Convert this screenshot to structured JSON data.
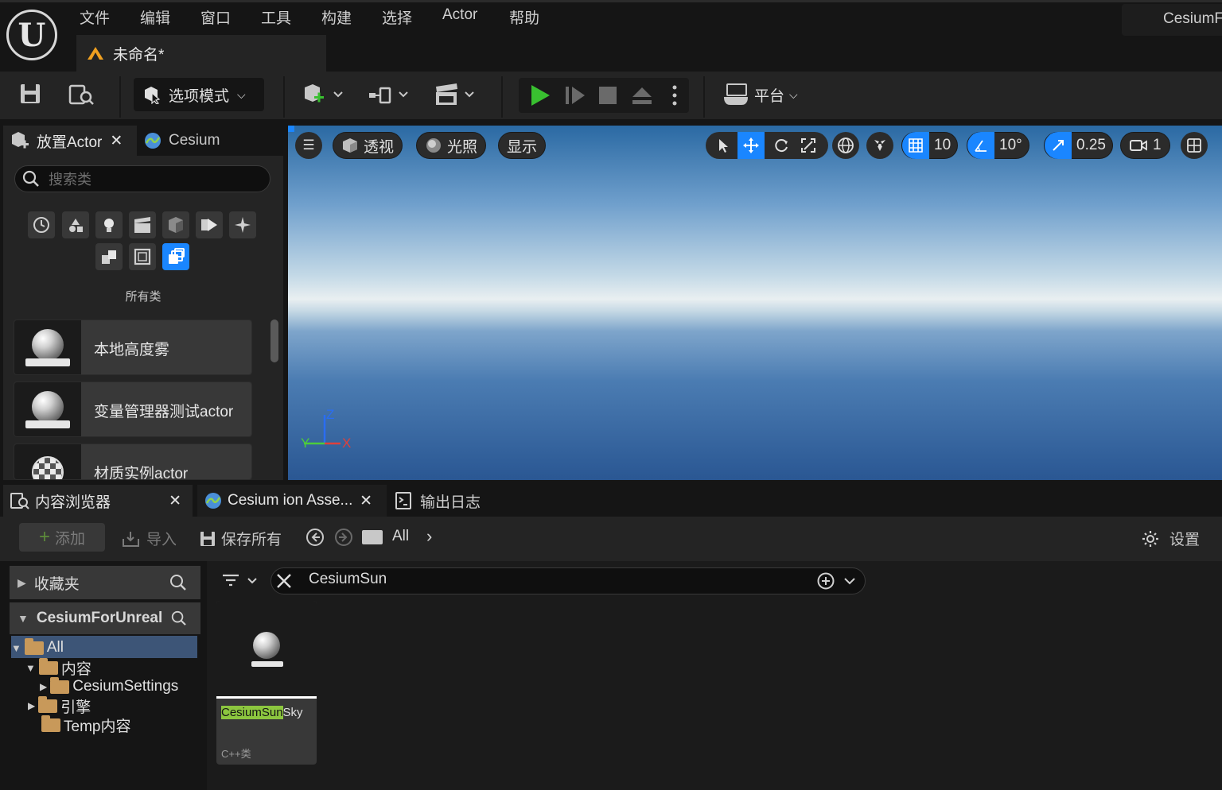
{
  "menu": {
    "items": [
      "文件",
      "编辑",
      "窗口",
      "工具",
      "构建",
      "选择",
      "Actor",
      "帮助"
    ],
    "project_tab": "未命名*",
    "project_name": "CesiumF"
  },
  "toolbar": {
    "mode_label": "选项模式",
    "platform_label": "平台"
  },
  "place_panel": {
    "tab_place": "放置Actor",
    "tab_cesium": "Cesium",
    "search_placeholder": "搜索类",
    "all_classes": "所有类",
    "items": [
      "本地高度雾",
      "变量管理器测试actor",
      "材质实例actor"
    ]
  },
  "viewport": {
    "view_mode": "透视",
    "lighting": "光照",
    "show": "显示",
    "grid_snap": "10",
    "rotation_snap": "10°",
    "scale_snap": "0.25",
    "camera_speed": "1",
    "axis_z": "Z",
    "axis_y": "Y",
    "axis_x": "X"
  },
  "bottom_tabs": {
    "content_browser": "内容浏览器",
    "cesium_ion": "Cesium ion Asse...",
    "output_log": "输出日志"
  },
  "content_browser": {
    "add": "添加",
    "import": "导入",
    "save_all": "保存所有",
    "path": "All",
    "settings": "设置",
    "favorites": "收藏夹",
    "project": "CesiumForUnreal",
    "tree": [
      "All",
      "内容",
      "CesiumSettings",
      "引擎",
      "Temp内容"
    ],
    "search_value": "CesiumSun",
    "asset": {
      "name_highlight": "CesiumSun",
      "name_rest": "Sky",
      "type": "C++类"
    }
  },
  "colors": {
    "accent": "#1a86ff",
    "play_green": "#39c030",
    "search_highlight": "#8cc63f"
  }
}
